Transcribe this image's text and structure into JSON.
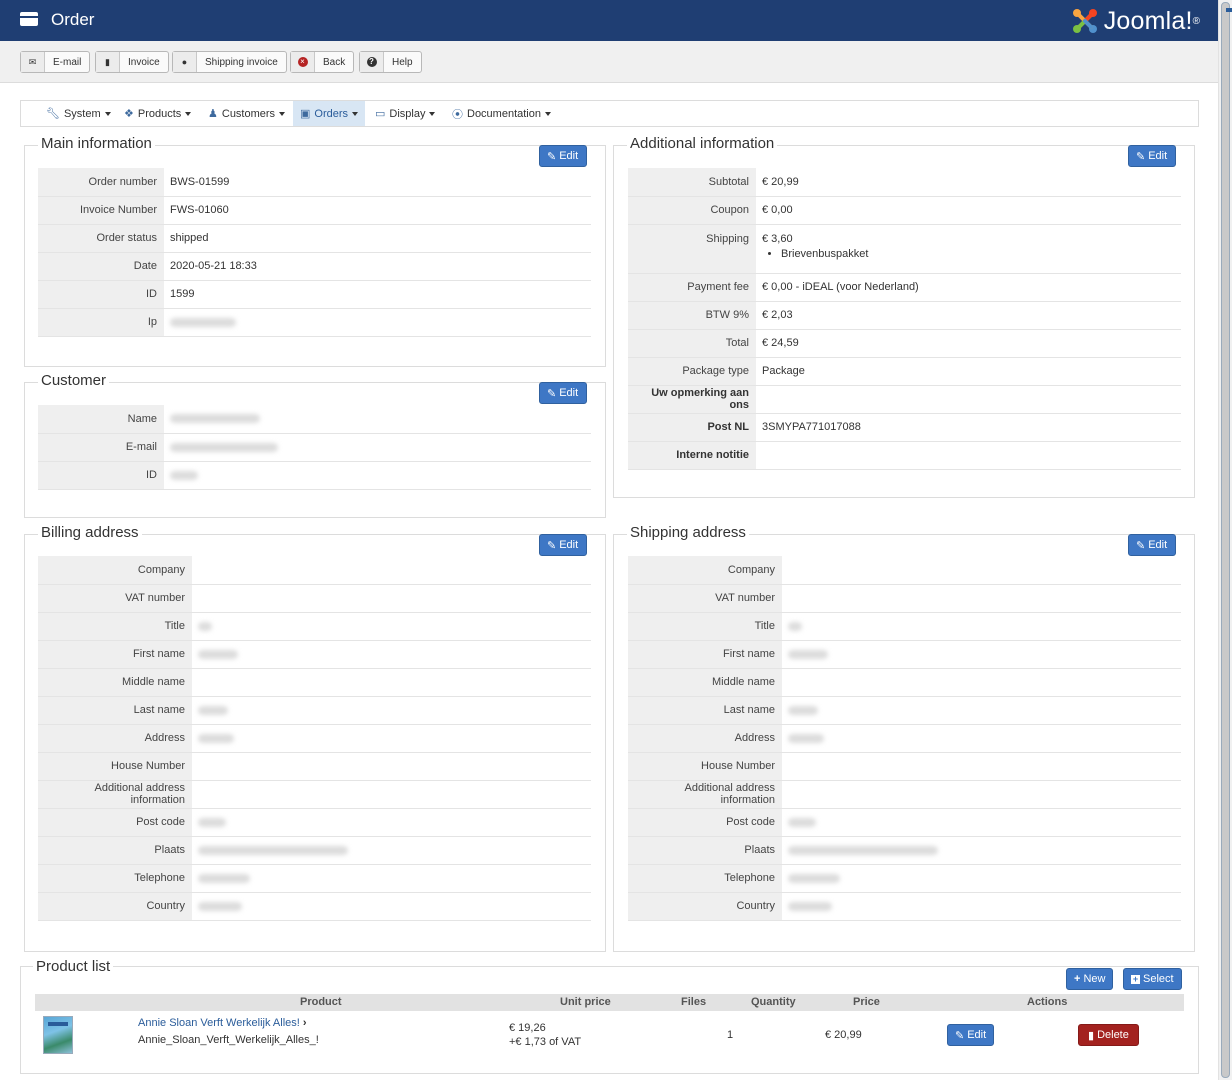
{
  "header": {
    "title": "Order",
    "logo_text": "Joomla!",
    "bg_color": "#1f3e73"
  },
  "toolbar": {
    "buttons": [
      {
        "icon": "envelope-icon",
        "label": "E-mail"
      },
      {
        "icon": "document-icon",
        "label": "Invoice"
      },
      {
        "icon": "map-pin-icon",
        "label": "Shipping invoice"
      },
      {
        "icon": "cancel-circle-icon",
        "label": "Back"
      },
      {
        "icon": "question-circle-icon",
        "label": "Help"
      }
    ]
  },
  "menu": {
    "items": [
      {
        "icon": "wrench-icon",
        "label": "System"
      },
      {
        "icon": "cubes-icon",
        "label": "Products"
      },
      {
        "icon": "user-icon",
        "label": "Customers"
      },
      {
        "icon": "credit-card-icon",
        "label": "Orders",
        "active": true
      },
      {
        "icon": "monitor-icon",
        "label": "Display"
      },
      {
        "icon": "lifebuoy-icon",
        "label": "Documentation"
      }
    ]
  },
  "edit_label": "Edit",
  "main_info": {
    "title": "Main information",
    "rows": [
      {
        "label": "Order number",
        "value": "BWS-01599"
      },
      {
        "label": "Invoice Number",
        "value": "FWS-01060"
      },
      {
        "label": "Order status",
        "value": "shipped"
      },
      {
        "label": "Date",
        "value": "2020-05-21 18:33"
      },
      {
        "label": "ID",
        "value": "1599"
      },
      {
        "label": "Ip",
        "value": ""
      }
    ]
  },
  "customer": {
    "title": "Customer",
    "rows": [
      {
        "label": "Name",
        "value": ""
      },
      {
        "label": "E-mail",
        "value": ""
      },
      {
        "label": "ID",
        "value": ""
      }
    ]
  },
  "additional_info": {
    "title": "Additional information",
    "rows": [
      {
        "label": "Subtotal",
        "value": "€ 20,99"
      },
      {
        "label": "Coupon",
        "value": "€ 0,00"
      },
      {
        "label": "Shipping",
        "value": "€ 3,60",
        "sub": "Brievenbuspakket"
      },
      {
        "label": "Payment fee",
        "value": "€ 0,00 - iDEAL (voor Nederland)"
      },
      {
        "label": "BTW 9%",
        "value": "€ 2,03"
      },
      {
        "label": "Total",
        "value": "€ 24,59"
      },
      {
        "label": "Package type",
        "value": "Package"
      },
      {
        "label": "Uw opmerking aan ons",
        "value": ""
      },
      {
        "label": "Post NL",
        "value": "3SMYPA771017088"
      },
      {
        "label": "Interne notitie",
        "value": ""
      }
    ]
  },
  "billing": {
    "title": "Billing address",
    "rows": [
      {
        "label": "Company"
      },
      {
        "label": "VAT number"
      },
      {
        "label": "Title"
      },
      {
        "label": "First name"
      },
      {
        "label": "Middle name"
      },
      {
        "label": "Last name"
      },
      {
        "label": "Address"
      },
      {
        "label": "House Number"
      },
      {
        "label": "Additional address information"
      },
      {
        "label": "Post code"
      },
      {
        "label": "Plaats"
      },
      {
        "label": "Telephone"
      },
      {
        "label": "Country"
      }
    ]
  },
  "shipping": {
    "title": "Shipping address",
    "rows": [
      {
        "label": "Company"
      },
      {
        "label": "VAT number"
      },
      {
        "label": "Title"
      },
      {
        "label": "First name"
      },
      {
        "label": "Middle name"
      },
      {
        "label": "Last name"
      },
      {
        "label": "Address"
      },
      {
        "label": "House Number"
      },
      {
        "label": "Additional address information"
      },
      {
        "label": "Post code"
      },
      {
        "label": "Plaats"
      },
      {
        "label": "Telephone"
      },
      {
        "label": "Country"
      }
    ]
  },
  "products": {
    "title": "Product list",
    "new_label": "New",
    "select_label": "Select",
    "columns": [
      "Product",
      "Unit price",
      "Files",
      "Quantity",
      "Price",
      "Actions"
    ],
    "rows": [
      {
        "name": "Annie Sloan Verft Werkelijk Alles!",
        "sku": "Annie_Sloan_Verft_Werkelijk_Alles_!",
        "unit_price": "€ 19,26",
        "vat": "+€ 1,73 of VAT",
        "files": "",
        "quantity": "1",
        "price": "€ 20,99",
        "edit_label": "Edit",
        "delete_label": "Delete"
      }
    ]
  }
}
